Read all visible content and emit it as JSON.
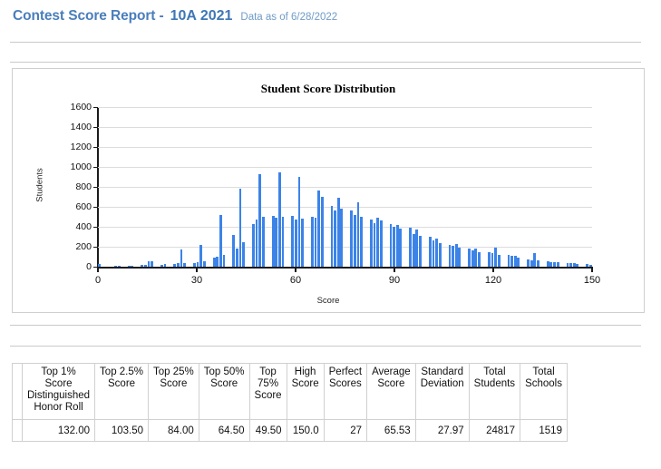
{
  "header": {
    "report_title": "Contest Score Report -",
    "contest_name": "10A 2021",
    "data_as_of": "Data as of 6/28/2022"
  },
  "chart": {
    "title": "Student Score Distribution",
    "xlabel": "Score",
    "ylabel": "Students",
    "bar_color": "#3c83e8",
    "grid_color": "#dcdcdc",
    "axis_color": "#1a1a1a"
  },
  "chart_data": {
    "type": "bar",
    "title": "Student Score Distribution",
    "xlabel": "Score",
    "ylabel": "Students",
    "xlim": [
      0,
      150
    ],
    "ylim": [
      0,
      1600
    ],
    "ytick_labels": [
      "0",
      "200",
      "400",
      "600",
      "800",
      "1000",
      "1200",
      "1400",
      "1600"
    ],
    "ytick_values": [
      0,
      200,
      400,
      600,
      800,
      1000,
      1200,
      1400,
      1600
    ],
    "xtick_labels": [
      "0",
      "30",
      "60",
      "90",
      "120",
      "150"
    ],
    "xtick_values": [
      0,
      30,
      60,
      90,
      120,
      150
    ],
    "grid": true,
    "legend": "none",
    "bin_width": 1,
    "x": [
      0,
      1,
      2,
      3,
      4,
      5,
      6,
      7,
      8,
      9,
      10,
      11,
      12,
      13,
      14,
      15,
      16,
      17,
      18,
      19,
      20,
      21,
      22,
      23,
      24,
      25,
      26,
      27,
      28,
      29,
      30,
      31,
      32,
      33,
      34,
      35,
      36,
      37,
      38,
      39,
      40,
      41,
      42,
      43,
      44,
      45,
      46,
      47,
      48,
      49,
      50,
      51,
      52,
      53,
      54,
      55,
      56,
      57,
      58,
      59,
      60,
      61,
      62,
      63,
      64,
      65,
      66,
      67,
      68,
      69,
      70,
      71,
      72,
      73,
      74,
      75,
      76,
      77,
      78,
      79,
      80,
      81,
      82,
      83,
      84,
      85,
      86,
      87,
      88,
      89,
      90,
      91,
      92,
      93,
      94,
      95,
      96,
      97,
      98,
      99,
      100,
      101,
      102,
      103,
      104,
      105,
      106,
      107,
      108,
      109,
      110,
      111,
      112,
      113,
      114,
      115,
      116,
      117,
      118,
      119,
      120,
      121,
      122,
      123,
      124,
      125,
      126,
      127,
      128,
      129,
      130,
      131,
      132,
      133,
      134,
      135,
      136,
      137,
      138,
      139,
      140,
      141,
      142,
      143,
      144,
      145,
      146,
      147,
      148,
      149,
      150
    ],
    "values": [
      0,
      0,
      0,
      0,
      0,
      4,
      6,
      0,
      0,
      8,
      10,
      0,
      0,
      14,
      16,
      55,
      58,
      0,
      0,
      22,
      24,
      0,
      0,
      30,
      32,
      170,
      34,
      0,
      0,
      40,
      44,
      220,
      58,
      0,
      0,
      95,
      100,
      520,
      120,
      0,
      0,
      320,
      180,
      780,
      250,
      0,
      0,
      430,
      470,
      930,
      500,
      0,
      0,
      505,
      490,
      950,
      500,
      0,
      0,
      505,
      470,
      900,
      480,
      0,
      0,
      500,
      495,
      760,
      700,
      0,
      0,
      610,
      560,
      690,
      580,
      0,
      0,
      560,
      520,
      650,
      500,
      0,
      0,
      470,
      440,
      495,
      460,
      0,
      0,
      430,
      400,
      420,
      380,
      0,
      0,
      390,
      330,
      370,
      310,
      0,
      0,
      300,
      260,
      280,
      240,
      0,
      0,
      220,
      210,
      230,
      190,
      0,
      0,
      185,
      160,
      180,
      150,
      0,
      0,
      150,
      140,
      190,
      120,
      0,
      0,
      120,
      105,
      110,
      95,
      0,
      0,
      70,
      60,
      140,
      65,
      0,
      0,
      55,
      45,
      50,
      42,
      0,
      0,
      38,
      32,
      35,
      30,
      0,
      0,
      24,
      22,
      28,
      20,
      0,
      0,
      30
    ]
  },
  "table": {
    "headers": [
      "Top 1% Score Distinguished Honor Roll",
      "Top 2.5% Score",
      "Top 25% Score",
      "Top 50% Score",
      "Top 75% Score",
      "High Score",
      "Perfect Scores",
      "Average Score",
      "Standard Deviation",
      "Total Students",
      "Total Schools"
    ],
    "header_lines": [
      [
        "Top 1%",
        "Score",
        "Distinguished",
        "Honor Roll"
      ],
      [
        "Top 2.5%",
        "Score"
      ],
      [
        "Top 25%",
        "Score"
      ],
      [
        "Top 50%",
        "Score"
      ],
      [
        "Top",
        "75%",
        "Score"
      ],
      [
        "High",
        "Score"
      ],
      [
        "Perfect",
        "Scores"
      ],
      [
        "Average",
        "Score"
      ],
      [
        "Standard",
        "Deviation"
      ],
      [
        "Total",
        "Students"
      ],
      [
        "Total",
        "Schools"
      ]
    ],
    "values": [
      "132.00",
      "103.50",
      "84.00",
      "64.50",
      "49.50",
      "150.0",
      "27",
      "65.53",
      "27.97",
      "24817",
      "1519"
    ]
  }
}
